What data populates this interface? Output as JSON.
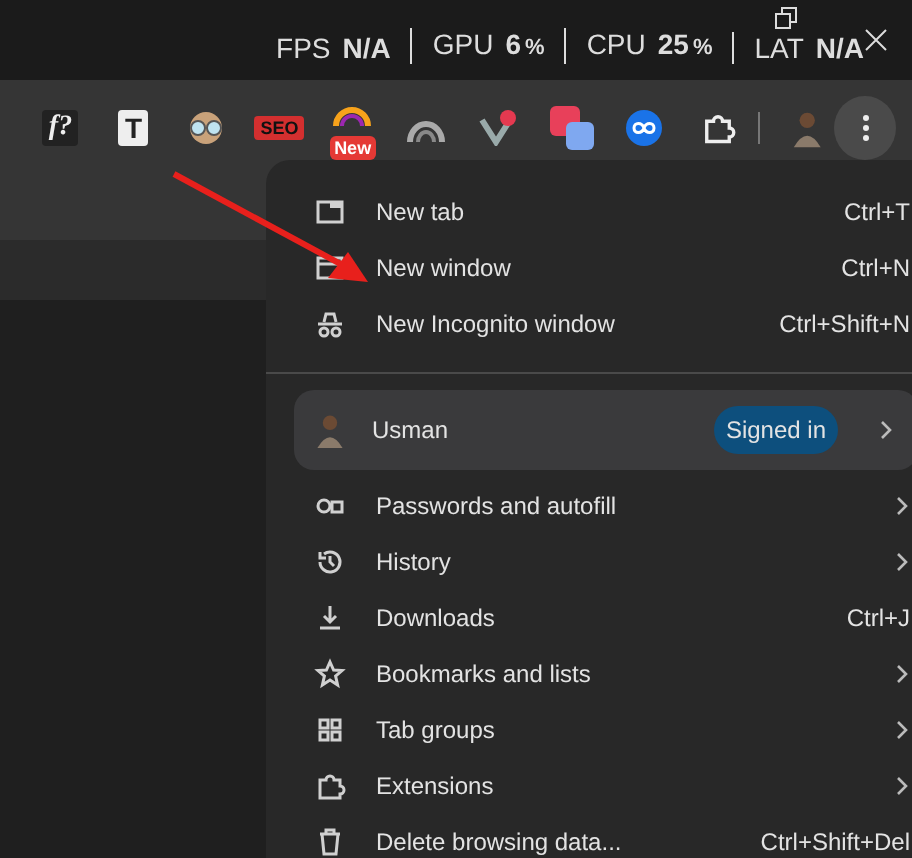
{
  "stats": [
    {
      "label": "FPS",
      "value": "N/A"
    },
    {
      "label": "GPU",
      "value": "6",
      "unit": "%"
    },
    {
      "label": "CPU",
      "value": "25",
      "unit": "%"
    },
    {
      "label": "LAT",
      "value": "N/A"
    }
  ],
  "extensions": [
    {
      "kind": "text-logo",
      "glyph": "f?"
    },
    {
      "kind": "text-logo",
      "glyph": "T"
    },
    {
      "kind": "goggles"
    },
    {
      "kind": "text-logo",
      "glyph": "SEO"
    },
    {
      "kind": "badge",
      "badge": "New"
    },
    {
      "kind": "arch"
    },
    {
      "kind": "shield"
    },
    {
      "kind": "paint"
    },
    {
      "kind": "link"
    },
    {
      "kind": "puzzle"
    }
  ],
  "menu": [
    {
      "kind": "item",
      "label": "New tab",
      "shortcut": "Ctrl+T",
      "submenu": false
    },
    {
      "kind": "item",
      "label": "New window",
      "shortcut": "Ctrl+N",
      "submenu": false
    },
    {
      "kind": "item",
      "label": "New Incognito window",
      "shortcut": "Ctrl+Shift+N",
      "submenu": false
    },
    {
      "kind": "divider"
    },
    {
      "kind": "profile",
      "label": "Usman",
      "badge": "Signed in",
      "submenu": true
    },
    {
      "kind": "item",
      "label": "Passwords and autofill",
      "submenu": true
    },
    {
      "kind": "item",
      "label": "History",
      "submenu": true
    },
    {
      "kind": "item",
      "label": "Downloads",
      "shortcut": "Ctrl+J",
      "submenu": false
    },
    {
      "kind": "item",
      "label": "Bookmarks and lists",
      "submenu": true
    },
    {
      "kind": "item",
      "label": "Tab groups",
      "submenu": true
    },
    {
      "kind": "item",
      "label": "Extensions",
      "submenu": true
    },
    {
      "kind": "item",
      "label": "Delete browsing data...",
      "shortcut": "Ctrl+Shift+Del",
      "submenu": false
    }
  ]
}
